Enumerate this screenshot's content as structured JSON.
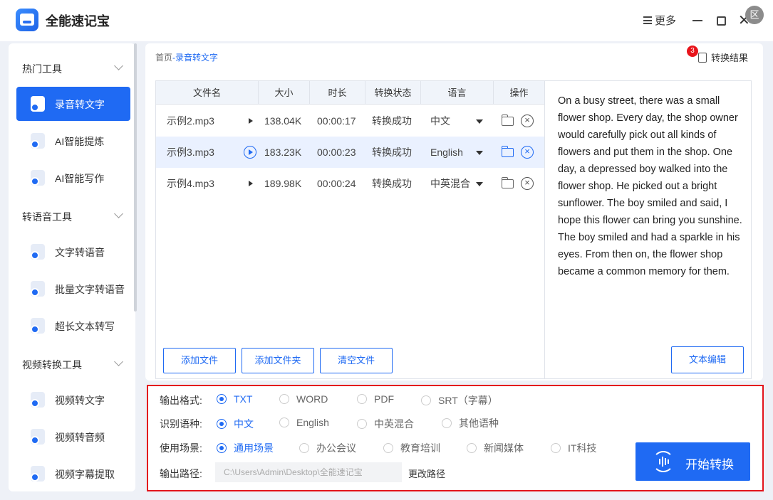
{
  "app": {
    "title": "全能速记宝",
    "more_label": "更多",
    "avatar_text": "区"
  },
  "sidebar": {
    "groups": [
      {
        "label": "热门工具"
      },
      {
        "label": "转语音工具"
      },
      {
        "label": "视频转换工具"
      }
    ],
    "items": [
      {
        "label": "录音转文字",
        "active": true,
        "icon": "audio-to-text-icon"
      },
      {
        "label": "AI智能提炼",
        "icon": "ai-extract-icon"
      },
      {
        "label": "AI智能写作",
        "icon": "ai-write-icon"
      },
      {
        "label": "文字转语音",
        "icon": "text-to-speech-icon"
      },
      {
        "label": "批量文字转语音",
        "icon": "batch-tts-icon"
      },
      {
        "label": "超长文本转写",
        "icon": "long-text-icon"
      },
      {
        "label": "视频转文字",
        "icon": "video-to-text-icon"
      },
      {
        "label": "视频转音频",
        "icon": "video-to-audio-icon"
      },
      {
        "label": "视频字幕提取",
        "icon": "subtitle-extract-icon"
      }
    ]
  },
  "main": {
    "breadcrumb": {
      "home": "首页",
      "sep": "-",
      "current": "录音转文字"
    },
    "result_label": "转换结果",
    "result_badge": "3",
    "table": {
      "headers": [
        "文件名",
        "大小",
        "时长",
        "转换状态",
        "语言",
        "操作"
      ],
      "rows": [
        {
          "name": "示例2.mp3",
          "size": "138.04K",
          "duration": "00:00:17",
          "status": "转换成功",
          "lang": "中文",
          "selected": false
        },
        {
          "name": "示例3.mp3",
          "size": "183.23K",
          "duration": "00:00:23",
          "status": "转换成功",
          "lang": "English",
          "selected": true
        },
        {
          "name": "示例4.mp3",
          "size": "189.98K",
          "duration": "00:00:24",
          "status": "转换成功",
          "lang": "中英混合",
          "selected": false
        }
      ]
    },
    "buttons": {
      "add_file": "添加文件",
      "add_folder": "添加文件夹",
      "clear": "清空文件",
      "edit_text": "文本编辑"
    },
    "transcript": "On a busy street, there was a small flower shop. Every day, the shop owner would carefully pick out all kinds of flowers and put them in the shop. One day, a depressed boy walked into the flower shop. He picked out a bright sunflower. The boy smiled and said, I hope this flower can bring you sunshine. The boy smiled and had a sparkle in his eyes. From then on, the flower shop became a common memory for them."
  },
  "settings": {
    "format": {
      "label": "输出格式:",
      "options": [
        "TXT",
        "WORD",
        "PDF",
        "SRT（字幕）"
      ],
      "selected": "TXT"
    },
    "language": {
      "label": "识别语种:",
      "options": [
        "中文",
        "English",
        "中英混合",
        "其他语种"
      ],
      "selected": "中文"
    },
    "scene": {
      "label": "使用场景:",
      "options": [
        "通用场景",
        "办公会议",
        "教育培训",
        "新闻媒体",
        "IT科技"
      ],
      "selected": "通用场景"
    },
    "path": {
      "label": "输出路径:",
      "value": "C:\\Users\\Admin\\Desktop\\全能速记宝",
      "change_label": "更改路径"
    },
    "start_label": "开始转换"
  },
  "colors": {
    "accent": "#1f6af3",
    "highlight_border": "#e3141c",
    "badge": "#e8141b"
  }
}
